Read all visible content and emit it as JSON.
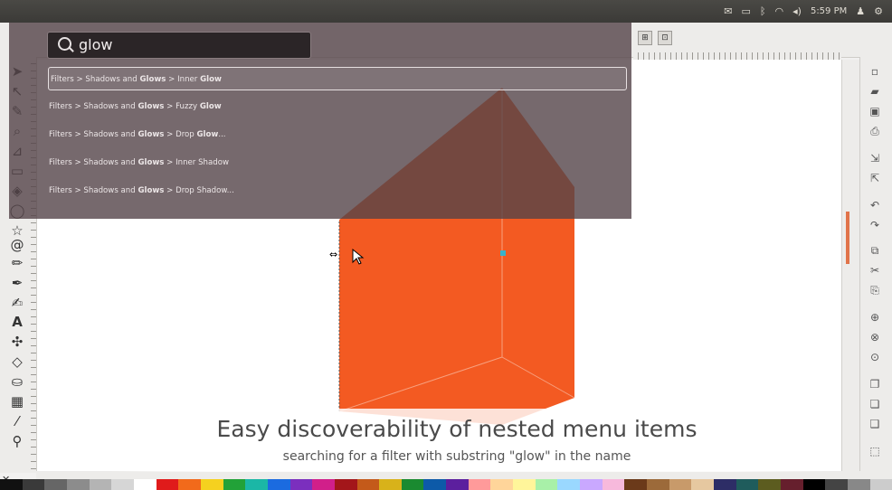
{
  "system_panel": {
    "time": "5:59 PM",
    "icons": [
      "mail-icon",
      "battery-icon",
      "bluetooth-icon",
      "wifi-icon",
      "volume-icon",
      "user-icon"
    ]
  },
  "hud": {
    "query": "glow",
    "results": [
      {
        "prefix": "Filters > Shadows and ",
        "match": "Glows",
        "mid": " > Inner ",
        "match2": "Glow",
        "suffix": ""
      },
      {
        "prefix": "Filters > Shadows and ",
        "match": "Glows",
        "mid": " > Fuzzy ",
        "match2": "Glow",
        "suffix": ""
      },
      {
        "prefix": "Filters > Shadows and ",
        "match": "Glows",
        "mid": " > Drop ",
        "match2": "Glow",
        "suffix": "..."
      },
      {
        "prefix": "Filters > Shadows and ",
        "match": "Glows",
        "mid": " > Inner Shadow",
        "match2": "",
        "suffix": ""
      },
      {
        "prefix": "Filters > Shadows and ",
        "match": "Glows",
        "mid": " > Drop Shadow...",
        "match2": "",
        "suffix": ""
      }
    ],
    "selected_index": 0
  },
  "caption": {
    "title": "Easy discoverability of nested menu items",
    "subtitle": "searching for a filter with substring \"glow\" in the name"
  },
  "colors": {
    "shape_fill": "#f35a22",
    "shape_dark": "#b4461d",
    "hud_bg": "#544448",
    "panel_bg": "#3b3a37"
  },
  "palette": [
    "#111111",
    "#3a3a3a",
    "#666666",
    "#8c8c8c",
    "#b4b4b4",
    "#d6d6d6",
    "#ffffff",
    "#e01b1b",
    "#f26a1b",
    "#f5d11f",
    "#22a238",
    "#1bb7a6",
    "#1b6be0",
    "#7b2fbe",
    "#d11f8a",
    "#a3161a",
    "#c45a1a",
    "#d8b21a",
    "#1a8a30",
    "#0d5aa8",
    "#5c1f9e",
    "#ff9a9a",
    "#ffd59a",
    "#fff59a",
    "#a8f0a8",
    "#9ad8ff",
    "#c9a8ff",
    "#f7b9dc",
    "#6b3a1a",
    "#9c6a3a",
    "#c89a6a",
    "#e6c8a0",
    "#2d2d66",
    "#1f5c5c",
    "#5c5c1f",
    "#661f2d",
    "#000000",
    "#444444",
    "#888888",
    "#cccccc"
  ]
}
